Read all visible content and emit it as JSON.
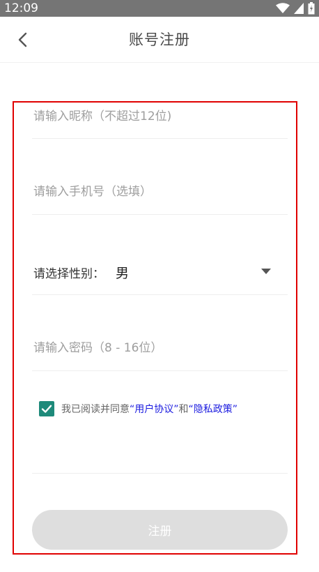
{
  "status_bar": {
    "time": "12:09"
  },
  "header": {
    "title": "账号注册"
  },
  "form": {
    "nickname": {
      "placeholder": "请输入昵称（不超过12位)"
    },
    "phone": {
      "placeholder": "请输入手机号（选填）"
    },
    "gender": {
      "label": "请选择性别：",
      "value": "男"
    },
    "password": {
      "placeholder": "请输入密码（8 - 16位）"
    },
    "agreement": {
      "checked": true,
      "prefix": "我已阅读并同意",
      "user_agreement": "“用户协议”",
      "and": "和",
      "privacy_policy": "“隐私政策”"
    },
    "submit_label": "注册"
  },
  "colors": {
    "accent": "#1e8a7a",
    "link": "#1a1adf",
    "frame": "#e00000"
  }
}
